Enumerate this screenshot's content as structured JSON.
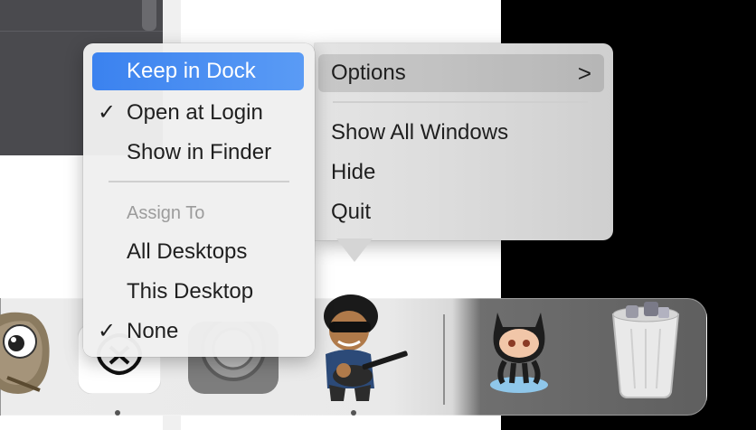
{
  "context_menu": {
    "items": [
      {
        "label": "Keep in Dock",
        "checked": false,
        "highlighted": true
      },
      {
        "label": "Open at Login",
        "checked": true
      },
      {
        "label": "Show in Finder",
        "checked": false
      }
    ],
    "section_header": "Assign To",
    "assign_items": [
      {
        "label": "All Desktops",
        "checked": false
      },
      {
        "label": "This Desktop",
        "checked": false
      },
      {
        "label": "None",
        "checked": true
      }
    ],
    "check_glyph": "✓"
  },
  "app_menu": {
    "options_label": "Options",
    "options_chevron": ">",
    "items": [
      "Show All Windows",
      "Hide",
      "Quit"
    ]
  },
  "dock": {
    "apps": [
      {
        "name": "gimp-like-app",
        "icon": "eye-mascot-icon",
        "running": false
      },
      {
        "name": "chatgpt-app",
        "icon": "chatgpt-logo-icon",
        "running": true
      },
      {
        "name": "system-settings",
        "icon": "gear-icon",
        "running": false
      },
      {
        "name": "guitarist-app",
        "icon": "guitarist-character-icon",
        "running": true
      },
      {
        "name": "github-desktop",
        "icon": "octocat-icon",
        "running": false
      },
      {
        "name": "trash",
        "icon": "trash-full-icon",
        "running": false
      }
    ]
  },
  "colors": {
    "highlight": "#3b82ef",
    "menu_bg": "#f0f0f0"
  }
}
